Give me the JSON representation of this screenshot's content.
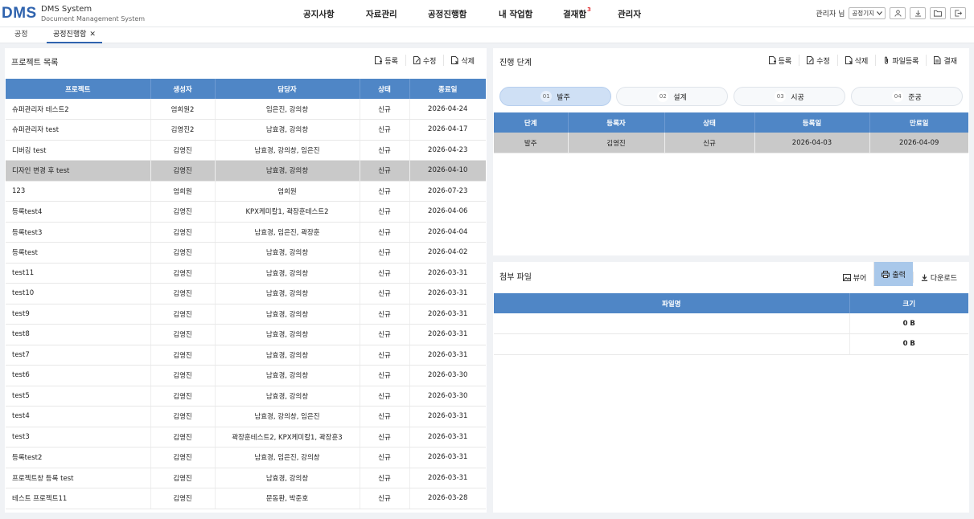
{
  "header": {
    "logo": "DMS",
    "app_name": "DMS System",
    "app_subtitle": "Document Management System",
    "menus": [
      {
        "label": "공지사항"
      },
      {
        "label": "자료관리"
      },
      {
        "label": "공정진행함"
      },
      {
        "label": "내 작업함"
      },
      {
        "label": "결재함",
        "badge": "3"
      },
      {
        "label": "관리자"
      }
    ],
    "user_label": "관리자 님",
    "select_value": "공정기지",
    "icons": [
      "user-icon",
      "download-icon",
      "folder-icon",
      "logout-icon"
    ]
  },
  "tabs": [
    {
      "label": "공정"
    },
    {
      "label": "공정진행함",
      "close": "✕"
    }
  ],
  "project_panel": {
    "title": "프로젝트 목록",
    "actions": {
      "register": "등록",
      "edit": "수정",
      "delete": "삭제"
    },
    "columns": [
      "프로젝트",
      "생성자",
      "담당자",
      "상태",
      "종료일"
    ],
    "rows": [
      [
        "슈퍼관리자 테스트2",
        "엄희원2",
        "임은진, 강의창",
        "신규",
        "2026-04-24"
      ],
      [
        "슈퍼관리자 test",
        "김영진2",
        "남효경, 강의창",
        "신규",
        "2026-04-17"
      ],
      [
        "디버깅 test",
        "김영진",
        "남효경, 강의창, 임은진",
        "신규",
        "2026-04-23"
      ],
      [
        "디자인 변경 후 test",
        "김영진",
        "남효경, 강의창",
        "신규",
        "2026-04-10"
      ],
      [
        "123",
        "엄희원",
        "엄희원",
        "신규",
        "2026-07-23"
      ],
      [
        "등록test4",
        "김영진",
        "KPX케미칼1, 곽장훈테스트2",
        "신규",
        "2026-04-06"
      ],
      [
        "등록test3",
        "김영진",
        "남효경, 임은진, 곽장훈",
        "신규",
        "2026-04-04"
      ],
      [
        "등록test",
        "김영진",
        "남효경, 강의창",
        "신규",
        "2026-04-02"
      ],
      [
        "test11",
        "김영진",
        "남효경, 강의창",
        "신규",
        "2026-03-31"
      ],
      [
        "test10",
        "김영진",
        "남효경, 강의창",
        "신규",
        "2026-03-31"
      ],
      [
        "test9",
        "김영진",
        "남효경, 강의창",
        "신규",
        "2026-03-31"
      ],
      [
        "test8",
        "김영진",
        "남효경, 강의창",
        "신규",
        "2026-03-31"
      ],
      [
        "test7",
        "김영진",
        "남효경, 강의창",
        "신규",
        "2026-03-31"
      ],
      [
        "test6",
        "김영진",
        "남효경, 강의창",
        "신규",
        "2026-03-30"
      ],
      [
        "test5",
        "김영진",
        "남효경, 강의창",
        "신규",
        "2026-03-30"
      ],
      [
        "test4",
        "김영진",
        "남효경, 강의창, 임은진",
        "신규",
        "2026-03-31"
      ],
      [
        "test3",
        "김영진",
        "곽장훈테스트2, KPX케미칼1, 곽장훈3",
        "신규",
        "2026-03-31"
      ],
      [
        "등록test2",
        "김영진",
        "남효경, 임은진, 강의창",
        "신규",
        "2026-03-31"
      ],
      [
        "프로젝트창 등록 test",
        "김영진",
        "남효경, 강의창",
        "신규",
        "2026-03-31"
      ],
      [
        "테스트 프로젝트11",
        "김영진",
        "문동환, 박준호",
        "신규",
        "2026-03-28"
      ]
    ],
    "selected_row": 3
  },
  "stage_panel": {
    "title": "진행 단계",
    "actions": {
      "register": "등록",
      "edit": "수정",
      "delete": "삭제",
      "file_register": "파일등록",
      "approve": "결재"
    },
    "stages": [
      {
        "num": "01",
        "label": "발주"
      },
      {
        "num": "02",
        "label": "설계"
      },
      {
        "num": "03",
        "label": "시공"
      },
      {
        "num": "04",
        "label": "준공"
      }
    ],
    "active_stage": 0,
    "columns": [
      "단계",
      "등록자",
      "상태",
      "등록일",
      "만료일"
    ],
    "rows": [
      [
        "발주",
        "김영진",
        "신규",
        "2026-04-03",
        "2026-04-09"
      ]
    ]
  },
  "file_panel": {
    "title": "첨부 파일",
    "actions": {
      "viewer": "뷰어",
      "print": "출력",
      "download": "다운로드"
    },
    "columns": [
      "파일명",
      "크기"
    ],
    "rows": [
      [
        "",
        "0 B"
      ],
      [
        "",
        "0 B"
      ]
    ]
  },
  "colors": {
    "brand": "#2f63ae",
    "table_header": "#4f86c6",
    "selected_row": "#c9c9c9",
    "active_stage": "#cfe0f5",
    "badge": "#e2393b"
  }
}
